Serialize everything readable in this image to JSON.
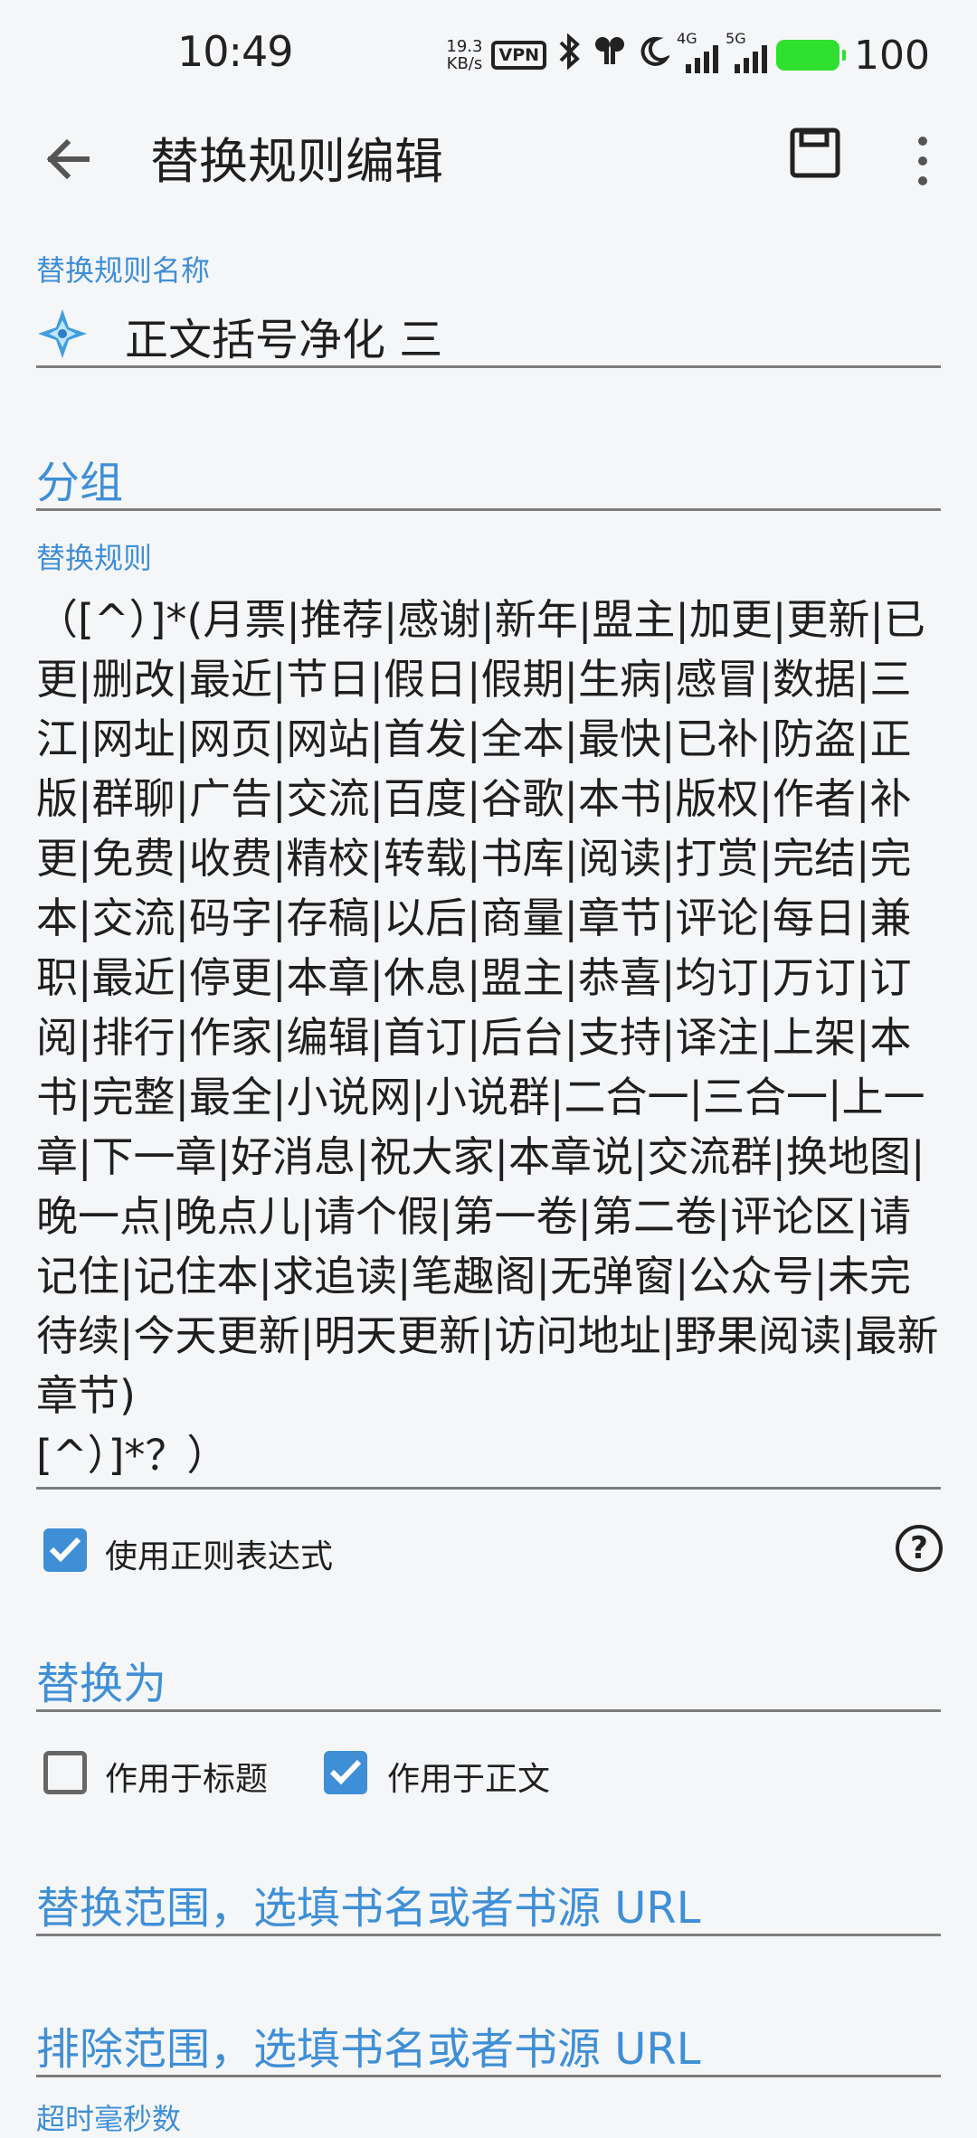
{
  "status_bar": {
    "time": "10:49",
    "speed_value": "19.3",
    "speed_unit": "KB/s",
    "vpn": "VPN",
    "net_4g": "4G",
    "net_5g": "5G",
    "battery": "100",
    "battery_color": "#2fe02f"
  },
  "toolbar": {
    "title": "替换规则编辑",
    "icons": [
      "back-arrow-icon",
      "save-icon",
      "more-vert-icon"
    ]
  },
  "form": {
    "name_label": "替换规则名称",
    "name_value": "正文括号净化 三",
    "group_placeholder": "分组",
    "rule_label": "替换规则",
    "rule_value": "（[^）]*(月票|推荐|感谢|新年|盟主|加更|更新|已更|删改|最近|节日|假日|假期|生病|感冒|数据|三江|网址|网页|网站|首发|全本|最快|已补|防盗|正版|群聊|广告|交流|百度|谷歌|本书|版权|作者|补更|免费|收费|精校|转载|书库|阅读|打赏|完结|完本|交流|码字|存稿|以后|商量|章节|评论|每日|兼职|最近|停更|本章|休息|盟主|恭喜|均订|万订|订阅|排行|作家|编辑|首订|后台|支持|译注|上架|本书|完整|最全|小说网|小说群|二合一|三合一|上一章|下一章|好消息|祝大家|本章说|交流群|换地图|晚一点|晚点儿|请个假|第一卷|第二卷|评论区|请记住|记住本|求追读|笔趣阁|无弹窗|公众号|未完待续|今天更新|明天更新|访问地址|野果阅读|最新章节)\n[^）]*？）",
    "use_regex_label": "使用正则表达式",
    "use_regex_checked": true,
    "replace_placeholder": "替换为",
    "apply_title_label": "作用于标题",
    "apply_title_checked": false,
    "apply_content_label": "作用于正文",
    "apply_content_checked": true,
    "scope_placeholder": "替换范围，选填书名或者书源 URL",
    "exclude_placeholder": "排除范围，选填书名或者书源 URL",
    "timeout_label": "超时毫秒数",
    "help_glyph": "?"
  },
  "colors": {
    "accent": "#3f8fd6",
    "background": "#f5f6f8",
    "text": "#1f1f1f"
  }
}
